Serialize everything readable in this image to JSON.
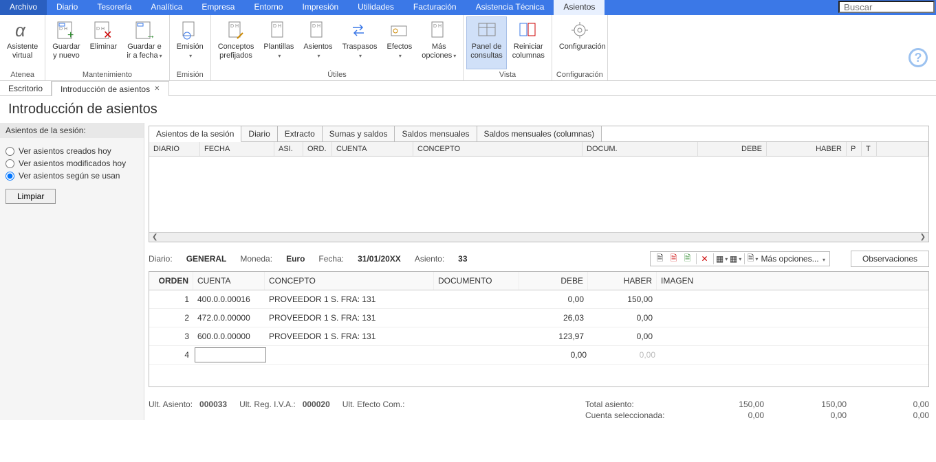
{
  "menu": [
    "Archivo",
    "Diario",
    "Tesorería",
    "Analítica",
    "Empresa",
    "Entorno",
    "Impresión",
    "Utilidades",
    "Facturación",
    "Asistencia Técnica",
    "Asientos"
  ],
  "menu_active_index": 10,
  "search_placeholder": "Buscar",
  "ribbon": {
    "groups": [
      {
        "label": "Atenea",
        "buttons": [
          {
            "name": "asistente-virtual",
            "label": "Asistente\nvirtual"
          }
        ]
      },
      {
        "label": "Mantenimiento",
        "buttons": [
          {
            "name": "guardar-nuevo",
            "label": "Guardar\ny nuevo"
          },
          {
            "name": "eliminar",
            "label": "Eliminar"
          },
          {
            "name": "guardar-ir-fecha",
            "label": "Guardar e\nir a fecha",
            "arrow": true
          }
        ]
      },
      {
        "label": "Emisión",
        "buttons": [
          {
            "name": "emision",
            "label": "Emisión",
            "arrow": true
          }
        ]
      },
      {
        "label": "Útiles",
        "buttons": [
          {
            "name": "conceptos-prefijados",
            "label": "Conceptos\nprefijados"
          },
          {
            "name": "plantillas",
            "label": "Plantillas",
            "arrow": true
          },
          {
            "name": "asientos",
            "label": "Asientos",
            "arrow": true
          },
          {
            "name": "traspasos",
            "label": "Traspasos",
            "arrow": true
          },
          {
            "name": "efectos",
            "label": "Efectos",
            "arrow": true
          },
          {
            "name": "mas-opciones",
            "label": "Más\nopciones",
            "arrow": true
          }
        ]
      },
      {
        "label": "Vista",
        "buttons": [
          {
            "name": "panel-consultas",
            "label": "Panel de\nconsultas",
            "active": true
          },
          {
            "name": "reiniciar-columnas",
            "label": "Reiniciar\ncolumnas"
          }
        ]
      },
      {
        "label": "Configuración",
        "buttons": [
          {
            "name": "configuracion",
            "label": "Configuración"
          }
        ]
      }
    ]
  },
  "doc_tabs": [
    {
      "label": "Escritorio",
      "closable": false,
      "active": false
    },
    {
      "label": "Introducción de asientos",
      "closable": true,
      "active": true
    }
  ],
  "page_title": "Introducción de asientos",
  "sidebar": {
    "header": "Asientos de la sesión:",
    "options": [
      {
        "label": "Ver asientos creados hoy",
        "selected": false
      },
      {
        "label": "Ver asientos modificados hoy",
        "selected": false
      },
      {
        "label": "Ver asientos según se usan",
        "selected": true
      }
    ],
    "clear_button": "Limpiar"
  },
  "inner_tabs": [
    "Asientos de la sesión",
    "Diario",
    "Extracto",
    "Sumas y saldos",
    "Saldos mensuales",
    "Saldos mensuales (columnas)"
  ],
  "inner_tab_active": 0,
  "upper_grid_columns": [
    "DIARIO",
    "FECHA",
    "ASI.",
    "ORD.",
    "CUENTA",
    "CONCEPTO",
    "DOCUM.",
    "DEBE",
    "HABER",
    "P",
    "T"
  ],
  "info": {
    "diario_label": "Diario:",
    "diario_value": "GENERAL",
    "moneda_label": "Moneda:",
    "moneda_value": "Euro",
    "fecha_label": "Fecha:",
    "fecha_value": "31/01/20XX",
    "asiento_label": "Asiento:",
    "asiento_value": "33",
    "mas_opciones": "Más opciones...",
    "observaciones": "Observaciones"
  },
  "lower_grid": {
    "columns": [
      "ORDEN",
      "CUENTA",
      "CONCEPTO",
      "DOCUMENTO",
      "DEBE",
      "HABER",
      "IMAGEN"
    ],
    "rows": [
      {
        "orden": "1",
        "cuenta": "400.0.0.00016",
        "concepto": "PROVEEDOR 1 S. FRA:  131",
        "documento": "",
        "debe": "0,00",
        "haber": "150,00"
      },
      {
        "orden": "2",
        "cuenta": "472.0.0.00000",
        "concepto": "PROVEEDOR 1 S. FRA:  131",
        "documento": "",
        "debe": "26,03",
        "haber": "0,00"
      },
      {
        "orden": "3",
        "cuenta": "600.0.0.00000",
        "concepto": "PROVEEDOR 1 S. FRA:  131",
        "documento": "",
        "debe": "123,97",
        "haber": "0,00"
      },
      {
        "orden": "4",
        "cuenta": "",
        "concepto": "",
        "documento": "",
        "debe": "0,00",
        "haber": "0,00",
        "editing": true,
        "haber_dim": true
      }
    ]
  },
  "status": {
    "ult_asiento_label": "Ult. Asiento:",
    "ult_asiento_value": "000033",
    "ult_reg_iva_label": "Ult. Reg. I.V.A.:",
    "ult_reg_iva_value": "000020",
    "ult_efecto_label": "Ult. Efecto Com.:",
    "ult_efecto_value": "",
    "total_asiento_label": "Total asiento:",
    "cuenta_sel_label": "Cuenta seleccionada:",
    "totals_row1": [
      "150,00",
      "150,00",
      "0,00"
    ],
    "totals_row2": [
      "0,00",
      "0,00",
      "0,00"
    ]
  }
}
